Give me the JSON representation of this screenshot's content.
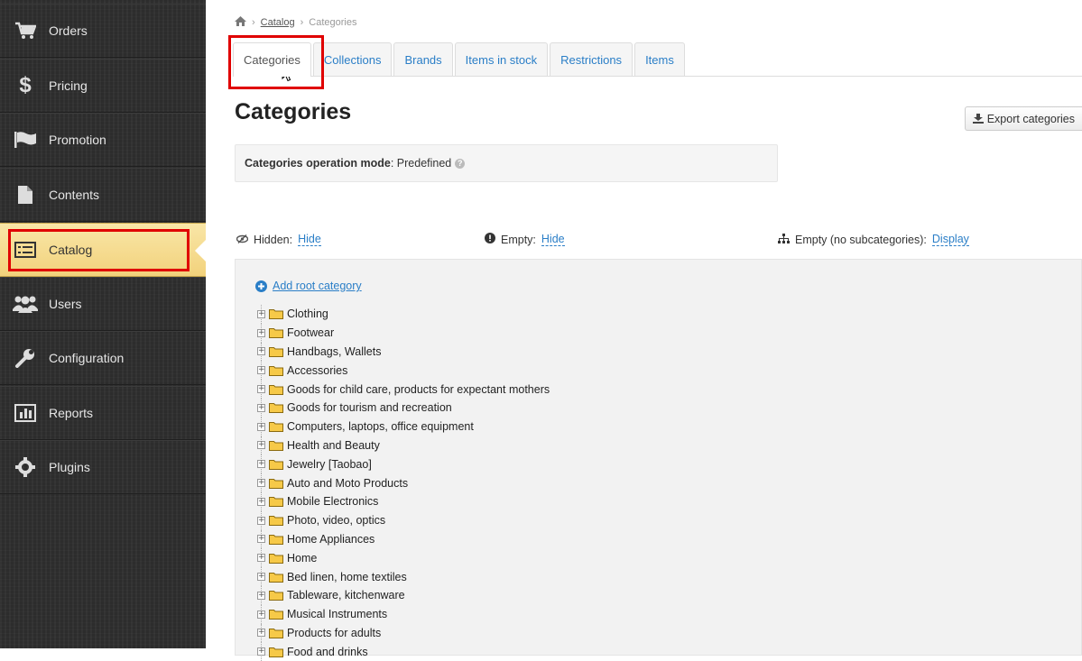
{
  "sidebar": {
    "items": [
      {
        "label": "Orders",
        "icon": "cart-icon"
      },
      {
        "label": "Pricing",
        "icon": "dollar-icon"
      },
      {
        "label": "Promotion",
        "icon": "flag-icon"
      },
      {
        "label": "Contents",
        "icon": "file-icon"
      },
      {
        "label": "Catalog",
        "icon": "list-icon",
        "active": true
      },
      {
        "label": "Users",
        "icon": "users-icon"
      },
      {
        "label": "Configuration",
        "icon": "wrench-icon"
      },
      {
        "label": "Reports",
        "icon": "bar-chart-icon"
      },
      {
        "label": "Plugins",
        "icon": "puzzle-icon"
      }
    ]
  },
  "breadcrumb": {
    "home_icon": "home-icon",
    "link": "Catalog",
    "current": "Categories"
  },
  "tabs": [
    {
      "label": "Categories",
      "active": true
    },
    {
      "label": "Collections"
    },
    {
      "label": "Brands"
    },
    {
      "label": "Items in stock"
    },
    {
      "label": "Restrictions"
    },
    {
      "label": "Items"
    }
  ],
  "page": {
    "title": "Categories",
    "export_label": "Export categories",
    "mode_label": "Categories operation mode",
    "mode_value": ": Predefined"
  },
  "filters": {
    "hidden_label": "Hidden:",
    "hidden_value": "Hide",
    "empty_label": "Empty:",
    "empty_value": "Hide",
    "nosub_label": "Empty (no subcategories):",
    "nosub_value": "Display"
  },
  "tree": {
    "add_root_label": "Add root category",
    "categories": [
      "Clothing",
      "Footwear",
      "Handbags, Wallets",
      "Accessories",
      "Goods for child care, products for expectant mothers",
      "Goods for tourism and recreation",
      "Computers, laptops, office equipment",
      "Health and Beauty",
      "Jewelry [Taobao]",
      "Auto and Moto Products",
      "Mobile Electronics",
      "Photo, video, optics",
      "Home Appliances",
      "Home",
      "Bed linen, home textiles",
      "Tableware, kitchenware",
      "Musical Instruments",
      "Products for adults",
      "Food and drinks"
    ]
  },
  "colors": {
    "accent": "#2a7ec7",
    "highlight": "#e00000",
    "sidebar_active": "#f2d27c",
    "sidebar_bg": "#2e2e2e"
  }
}
